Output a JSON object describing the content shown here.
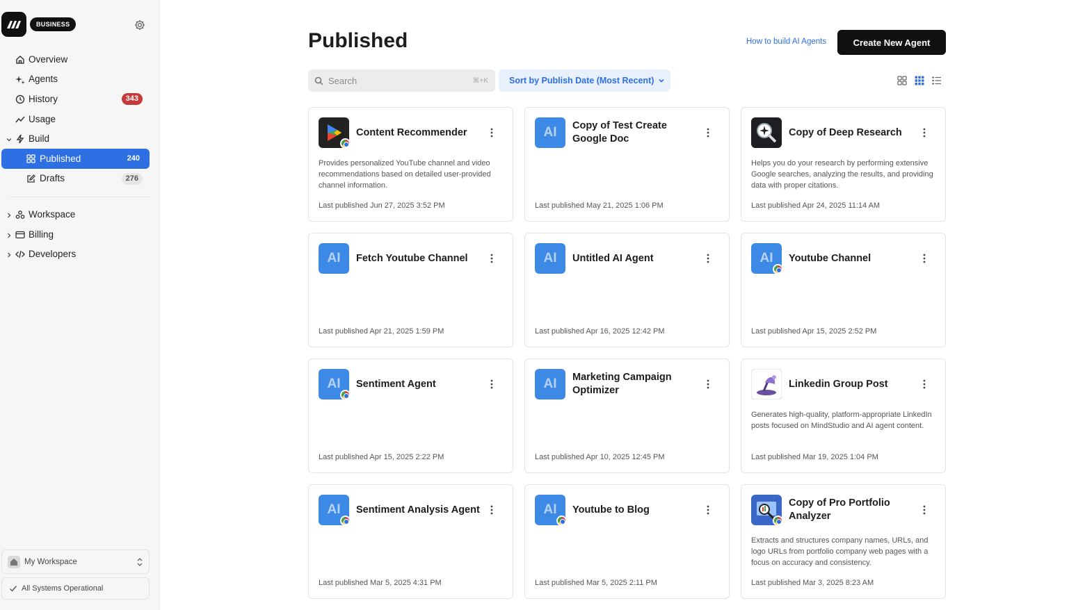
{
  "sidebar": {
    "brand_badge": "BUSINESS",
    "nav": [
      {
        "label": "Overview"
      },
      {
        "label": "Agents"
      },
      {
        "label": "History",
        "count": "343"
      },
      {
        "label": "Usage"
      },
      {
        "label": "Build"
      },
      {
        "label": "Published",
        "count": "240"
      },
      {
        "label": "Drafts",
        "count": "276"
      },
      {
        "label": "Workspace"
      },
      {
        "label": "Billing"
      },
      {
        "label": "Developers"
      }
    ],
    "workspace": "My Workspace",
    "status": "All Systems Operational"
  },
  "header": {
    "title": "Published",
    "howto_link": "How to build AI Agents",
    "create_button": "Create New Agent"
  },
  "toolbar": {
    "search_placeholder": "Search",
    "search_shortcut": "⌘+K",
    "sort_label": "Sort by Publish Date (Most Recent)"
  },
  "colors": {
    "accent": "#2f6fe4",
    "count_red": "#c73a3a",
    "ai_tile": "#3d8ae6"
  },
  "cards": [
    {
      "name": "Content Recommender",
      "icon": "play-store-icon",
      "chrome": true,
      "desc": "Provides personalized YouTube channel and video recommendations based on detailed user-provided channel information.",
      "published": "Last published Jun 27, 2025 3:52 PM"
    },
    {
      "name": "Copy of Test Create Google Doc",
      "icon": "AI",
      "chrome": false,
      "desc": "",
      "published": "Last published May 21, 2025 1:06 PM"
    },
    {
      "name": "Copy of Deep Research",
      "icon": "magnifier-icon",
      "chrome": false,
      "desc": "Helps you do your research by performing extensive Google searches, analyzing the results, and providing data with proper citations.",
      "published": "Last published Apr 24, 2025 11:14 AM"
    },
    {
      "name": "Fetch Youtube Channel",
      "icon": "AI",
      "chrome": false,
      "desc": "",
      "published": "Last published Apr 21, 2025 1:59 PM"
    },
    {
      "name": "Untitled AI Agent",
      "icon": "AI",
      "chrome": false,
      "desc": "",
      "published": "Last published Apr 16, 2025 12:42 PM"
    },
    {
      "name": "Youtube Channel",
      "icon": "AI",
      "chrome": true,
      "desc": "",
      "published": "Last published Apr 15, 2025 2:52 PM"
    },
    {
      "name": "Sentiment Agent",
      "icon": "AI",
      "chrome": true,
      "desc": "",
      "published": "Last published Apr 15, 2025 2:22 PM"
    },
    {
      "name": "Marketing Campaign Optimizer",
      "icon": "AI",
      "chrome": false,
      "desc": "",
      "published": "Last published Apr 10, 2025 12:45 PM"
    },
    {
      "name": "Linkedin Group Post",
      "icon": "gramophone-icon",
      "chrome": false,
      "desc": "Generates high-quality, platform-appropriate LinkedIn posts focused on MindStudio and AI agent content.",
      "published": "Last published Mar 19, 2025 1:04 PM"
    },
    {
      "name": "Sentiment Analysis Agent",
      "icon": "AI",
      "chrome": true,
      "desc": "",
      "published": "Last published Mar 5, 2025 4:31 PM"
    },
    {
      "name": "Youtube to Blog",
      "icon": "AI",
      "chrome": true,
      "desc": "",
      "published": "Last published Mar 5, 2025 2:11 PM"
    },
    {
      "name": "Copy of Pro Portfolio Analyzer",
      "icon": "portfolio-icon",
      "chrome": true,
      "desc": "Extracts and structures company names, URLs, and logo URLs from portfolio company web pages with a focus on accuracy and consistency.",
      "published": "Last published Mar 3, 2025 8:23 AM"
    }
  ]
}
